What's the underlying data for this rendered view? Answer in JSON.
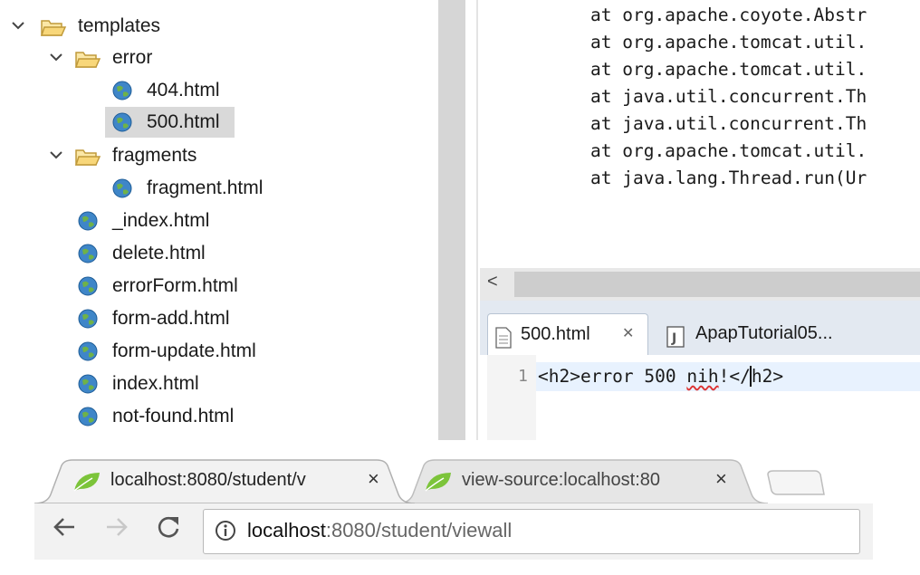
{
  "tree": {
    "root": "templates",
    "folders": {
      "error": "error",
      "fragments": "fragments"
    },
    "files_error": [
      "404.html",
      "500.html"
    ],
    "files_fragments": [
      "fragment.html"
    ],
    "files_root": [
      "_index.html",
      "delete.html",
      "errorForm.html",
      "form-add.html",
      "form-update.html",
      "index.html",
      "not-found.html"
    ],
    "selected": "500.html"
  },
  "console": {
    "lines": [
      "at org.apache.coyote.Abstr",
      "at org.apache.tomcat.util.",
      "at org.apache.tomcat.util.",
      "at java.util.concurrent.Th",
      "at java.util.concurrent.Th",
      "at org.apache.tomcat.util.",
      "at java.lang.Thread.run(Ur"
    ],
    "scroll_left": "<"
  },
  "editor": {
    "tabs": [
      {
        "label": "500.html",
        "close": "✕"
      },
      {
        "label": "ApapTutorial05..."
      }
    ],
    "line_number": "1",
    "code_before": "<h2>error 500 ",
    "code_misspelled": "nih",
    "code_after": "!</",
    "code_end": "h2>"
  },
  "browser": {
    "tabs": [
      {
        "title": "localhost:8080/student/v",
        "close": "×"
      },
      {
        "title": "view-source:localhost:80",
        "close": "×"
      }
    ],
    "url_host": "localhost",
    "url_rest": ":8080/student/viewall",
    "colors": {
      "favicon": "#7cc43a",
      "toolbar": "#f2f2f2"
    }
  }
}
